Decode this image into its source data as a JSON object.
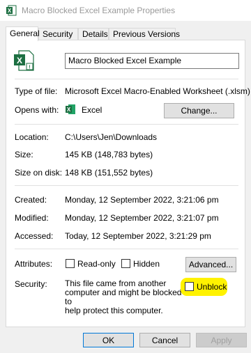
{
  "window": {
    "title": "Macro Blocked Excel Example Properties"
  },
  "tabs": [
    {
      "label": "General"
    },
    {
      "label": "Security"
    },
    {
      "label": "Details"
    },
    {
      "label": "Previous Versions"
    }
  ],
  "file": {
    "name": "Macro Blocked Excel Example",
    "icon": "excel-macro-file-icon"
  },
  "properties": {
    "type_label": "Type of file:",
    "type_value": "Microsoft Excel Macro-Enabled Worksheet (.xlsm)",
    "opens_label": "Opens with:",
    "opens_value": "Excel",
    "change_button": "Change...",
    "location_label": "Location:",
    "location_value": "C:\\Users\\Jen\\Downloads",
    "size_label": "Size:",
    "size_value": "145 KB (148,783 bytes)",
    "size_disk_label": "Size on disk:",
    "size_disk_value": "148 KB (151,552 bytes)",
    "created_label": "Created:",
    "created_value": "Monday, 12 September 2022, 3:21:06 pm",
    "modified_label": "Modified:",
    "modified_value": "Monday, 12 September 2022, 3:21:07 pm",
    "accessed_label": "Accessed:",
    "accessed_value": "Today, 12 September 2022, 3:21:29 pm",
    "attributes_label": "Attributes:",
    "readonly_label": "Read-only",
    "hidden_label": "Hidden",
    "advanced_button": "Advanced...",
    "security_label": "Security:",
    "security_line1": "This file came from another",
    "security_line2": "computer and might be blocked to",
    "security_line3": "help protect this computer.",
    "unblock_label": "Unblock"
  },
  "buttons": {
    "ok": "OK",
    "cancel": "Cancel",
    "apply": "Apply"
  },
  "colors": {
    "excel_green": "#1d6f42",
    "highlight": "#fff200"
  }
}
